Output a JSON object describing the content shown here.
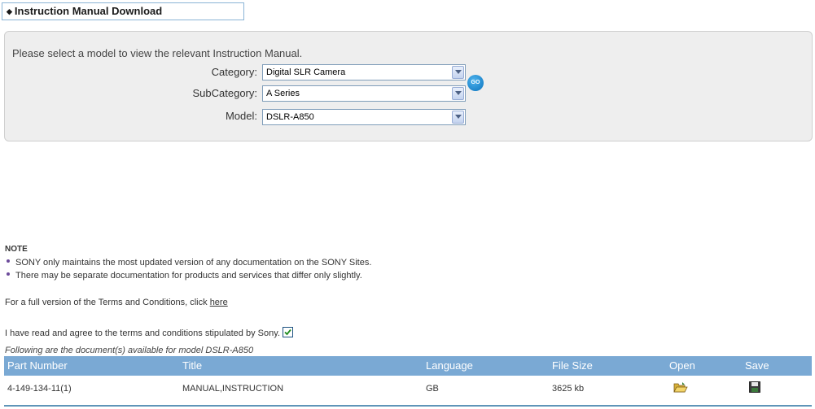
{
  "header": {
    "title": "Instruction Manual Download"
  },
  "selector": {
    "intro": "Please select a model to view the relevant Instruction Manual.",
    "category_label": "Category:",
    "category_value": "Digital SLR Camera",
    "subcategory_label": "SubCategory:",
    "subcategory_value": "A Series",
    "model_label": "Model:",
    "model_value": "DSLR-A850",
    "go_label": "GO"
  },
  "note": {
    "title": "NOTE",
    "items": [
      "SONY only maintains the most updated version of any documentation on the SONY Sites.",
      "There may be separate documentation for products and services that differ only slightly."
    ],
    "terms_text": "For a full version of the Terms and Conditions, click ",
    "terms_link": "here",
    "agree_text": "I have read and agree to the terms and conditions stipulated by Sony.",
    "agree_checked": true
  },
  "documents": {
    "caption": "Following are the document(s) available for model DSLR-A850",
    "columns": [
      "Part Number",
      "Title",
      "Language",
      "File Size",
      "Open",
      "Save"
    ],
    "rows": [
      {
        "part_number": "4-149-134-11(1)",
        "title": "MANUAL,INSTRUCTION",
        "language": "GB",
        "file_size": "3625 kb",
        "open_icon": "folder-open-icon",
        "save_icon": "floppy-disk-icon"
      }
    ]
  }
}
